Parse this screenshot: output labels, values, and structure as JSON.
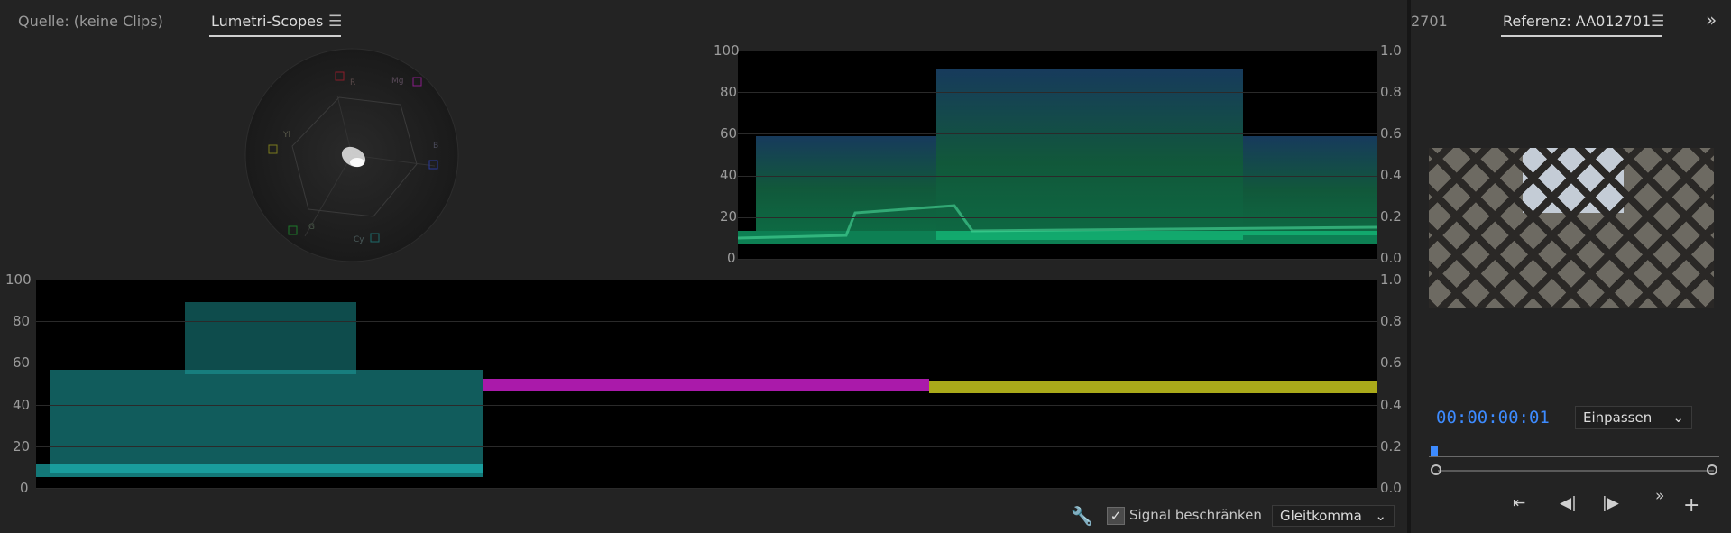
{
  "left_panel": {
    "tabs": [
      {
        "label": "Quelle: (keine Clips)"
      },
      {
        "label": "Lumetri-Scopes"
      }
    ],
    "vectorscope": {
      "targets": [
        "R",
        "Mg",
        "B",
        "Cy",
        "G",
        "Yl"
      ]
    },
    "luma_waveform": {
      "left_ticks": [
        "100",
        "80",
        "60",
        "40",
        "20",
        "0"
      ],
      "right_ticks": [
        "1.0",
        "0.8",
        "0.6",
        "0.4",
        "0.2",
        "0.0"
      ]
    },
    "parade_waveform": {
      "left_ticks": [
        "100",
        "80",
        "60",
        "40",
        "20",
        "0"
      ],
      "right_ticks": [
        "1.0",
        "0.8",
        "0.6",
        "0.4",
        "0.2",
        "0.0"
      ],
      "channel_colors": [
        "#1fa8a8",
        "#c81fc8",
        "#c8c81f"
      ]
    },
    "bottom_bar": {
      "signal_label": "Signal beschränken",
      "signal_checked": true,
      "mode_value": "Gleitkomma"
    }
  },
  "right_panel": {
    "tab_partial": "2701",
    "tab_label": "Referenz: AA012701",
    "overflow_symbol": "»",
    "timecode": "00:00:00:01",
    "fit_value": "Einpassen"
  }
}
